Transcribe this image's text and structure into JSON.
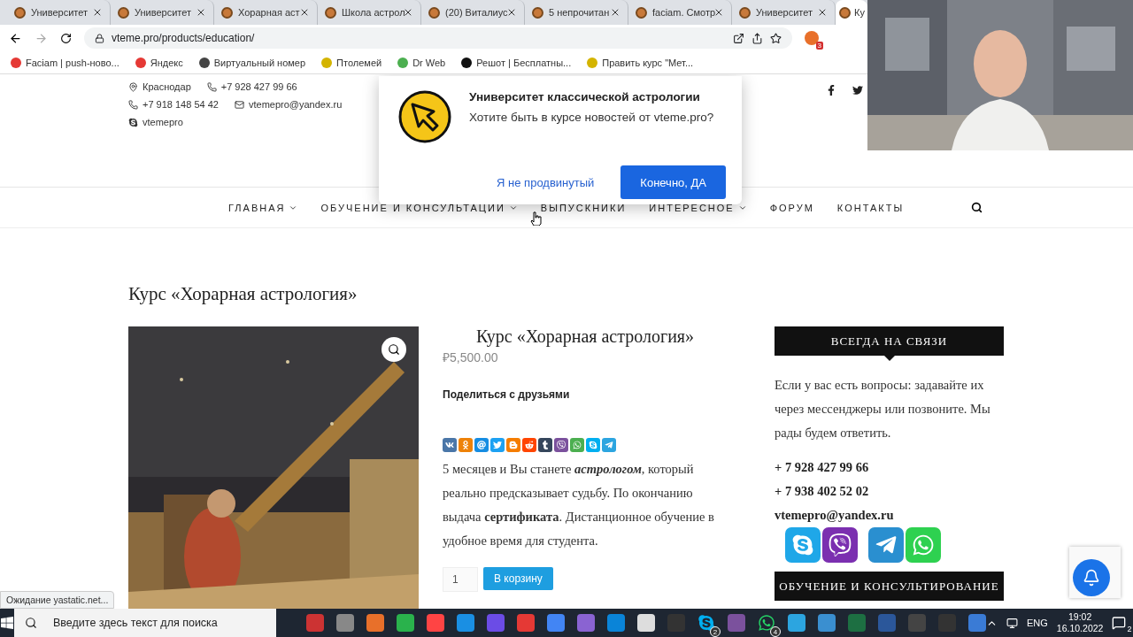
{
  "browser": {
    "tabs": [
      {
        "title": "Университет",
        "selected": false
      },
      {
        "title": "Университет",
        "selected": false
      },
      {
        "title": "Хорарная аст",
        "selected": false
      },
      {
        "title": "Школа астрол",
        "selected": false
      },
      {
        "title": "(20) Виталиус",
        "selected": false
      },
      {
        "title": "5 непрочитан",
        "selected": false
      },
      {
        "title": "faciam. Смотр",
        "selected": false
      },
      {
        "title": "Университет",
        "selected": false
      },
      {
        "title": "Ку",
        "selected": true
      }
    ],
    "url": "vteme.pro/products/education/",
    "extension_badge": "3",
    "bookmarks": [
      {
        "label": "Faciam | push-ново..."
      },
      {
        "label": "Яндекс"
      },
      {
        "label": "Виртуальный номер"
      },
      {
        "label": "Птолемей"
      },
      {
        "label": "Dr Web"
      },
      {
        "label": "Решот | Бесплатны..."
      },
      {
        "label": "Править курс \"Мет..."
      }
    ]
  },
  "header": {
    "contacts": [
      [
        {
          "kind": "place",
          "text": "Краснодар"
        },
        {
          "kind": "phone",
          "text": "+7 928 427 99 66"
        }
      ],
      [
        {
          "kind": "phone",
          "text": "+7 918 148 54 42"
        },
        {
          "kind": "mail",
          "text": "vtemepro@yandex.ru"
        }
      ],
      [
        {
          "kind": "skype",
          "text": "vtemepro"
        }
      ]
    ]
  },
  "popup": {
    "title": "Университет классической астрологии",
    "message": "Хотите быть в курсе новостей от vteme.pro?",
    "decline": "Я не продвинутый",
    "accept": "Конечно, ДА"
  },
  "nav": [
    {
      "label": "ГЛАВНАЯ",
      "dropdown": true
    },
    {
      "label": "ОБУЧЕНИЕ И КОНСУЛЬТАЦИИ",
      "dropdown": true
    },
    {
      "label": "ВЫПУСКНИКИ",
      "dropdown": false
    },
    {
      "label": "ИНТЕРЕСНОЕ",
      "dropdown": true
    },
    {
      "label": "ФОРУМ",
      "dropdown": false
    },
    {
      "label": "КОНТАКТЫ",
      "dropdown": false
    }
  ],
  "page_title": "Курс «Хорарная астрология»",
  "product": {
    "title": "Курс «Хорарная астрология»",
    "price": "₽5,500.00",
    "share_label": "Поделиться с друзьями",
    "description": "5 месяцев и Вы станете *астрологом*, который реально предсказывает судьбу. По окончанию выдача **сертификата**. Дистанционное обучение в удобное время для студента.",
    "quantity": "1",
    "add_to_cart": "В корзину"
  },
  "sidebar": {
    "heading": "ВСЕГДА НА СВЯЗИ",
    "text": "Если у вас есть вопросы: задавайте их через мессенджеры или позвоните. Мы рады будем ответить.",
    "contacts": [
      "+ 7 928 427 99 66",
      "+ 7 938 402 52 02",
      "vtemepro@yandex.ru"
    ],
    "next_heading": "ОБУЧЕНИЕ И КОНСУЛЬТИРОВАНИЕ"
  },
  "status_bubble": "Ожидание yastatic.net...",
  "taskbar": {
    "search_placeholder": "Введите здесь текст для поиска",
    "app_badges": [
      {
        "kind": "skype",
        "badge": "2"
      },
      {
        "kind": "whatsapp",
        "badge": "4"
      }
    ],
    "language": "ENG",
    "time": "19:02",
    "date": "16.10.2022",
    "notifications": "2"
  }
}
